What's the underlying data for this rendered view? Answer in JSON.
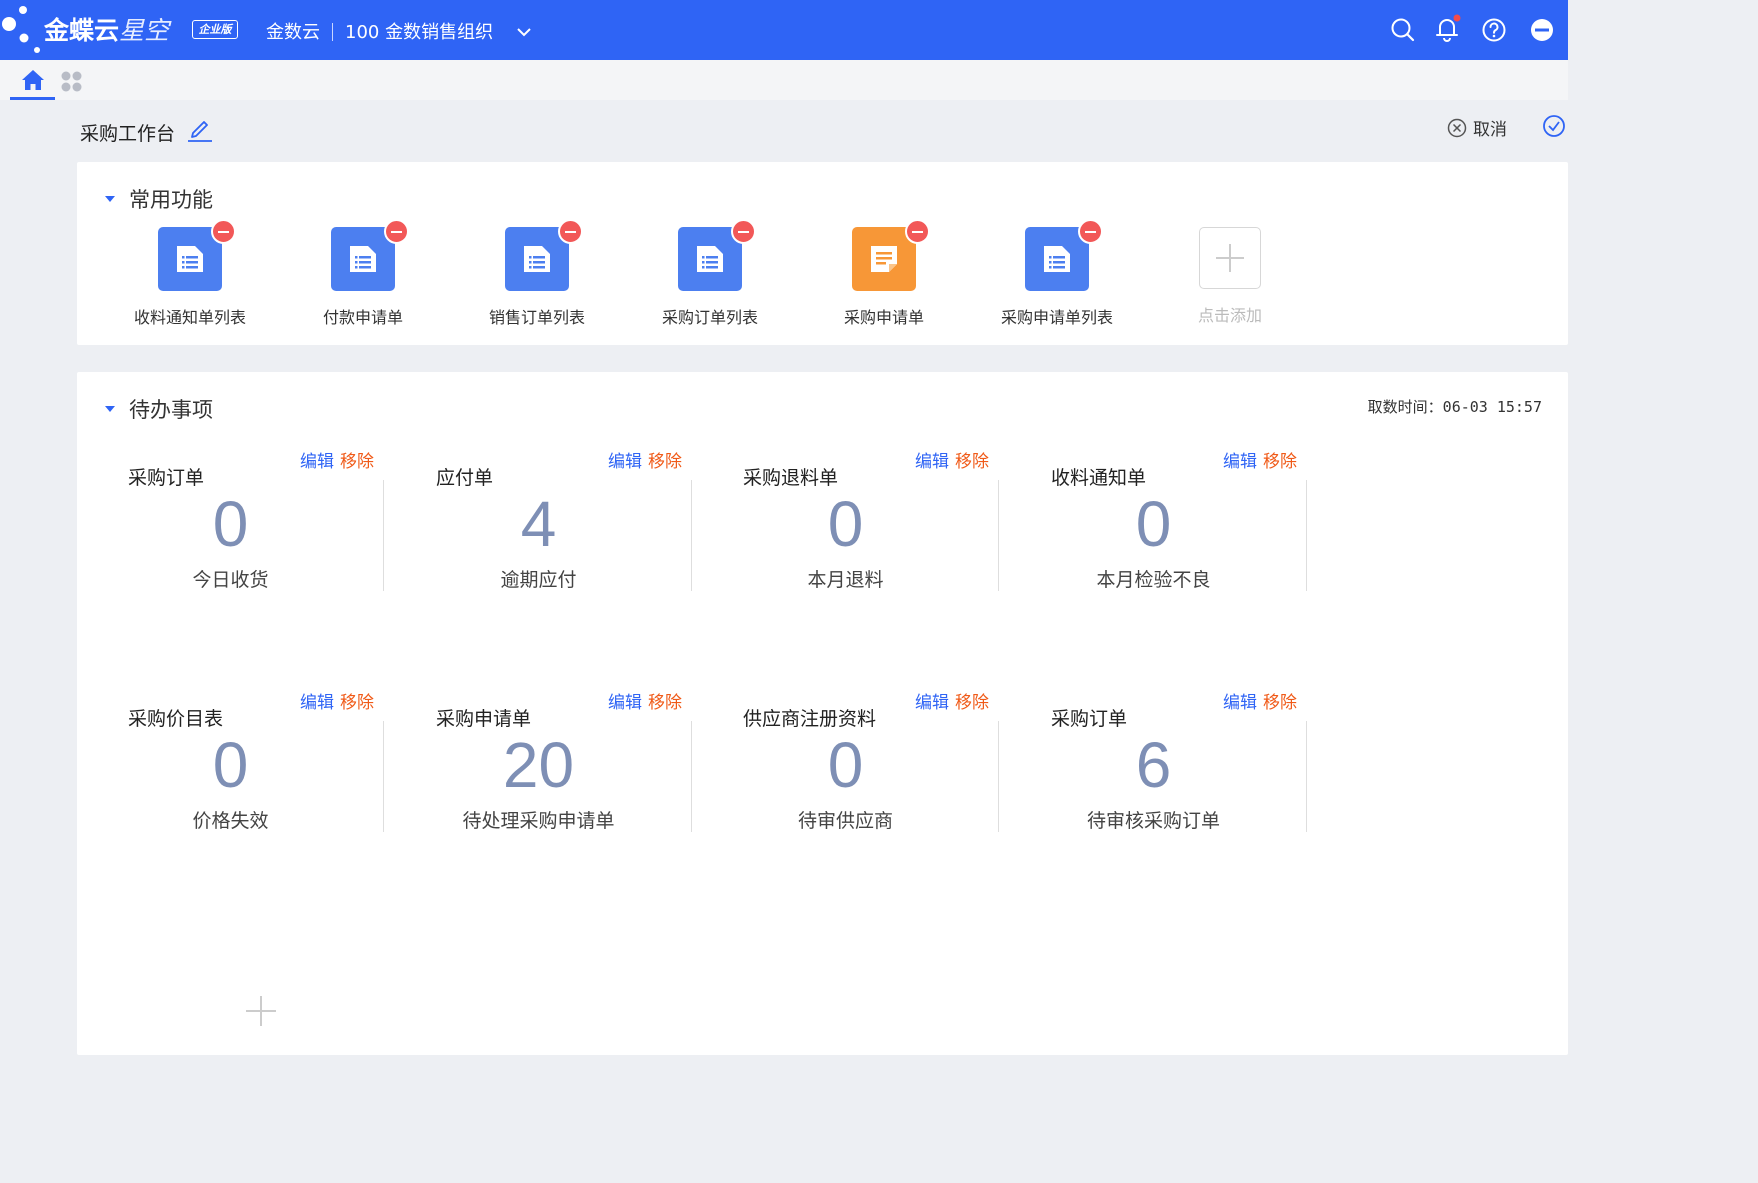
{
  "header": {
    "brand_primary": "金蝶云",
    "brand_secondary": "星空",
    "edition_badge": "企业版",
    "tenant": "金数云",
    "org": "100 金数销售组织",
    "accent_color": "#2f64f5",
    "icons": [
      "search-icon",
      "bell-icon",
      "help-icon",
      "user-menu-icon"
    ]
  },
  "tabs": {
    "icons": [
      "home-icon",
      "apps-grid-icon"
    ]
  },
  "page": {
    "title": "采购工作台",
    "cancel_label": "取消"
  },
  "common": {
    "title": "常用功能",
    "items": [
      {
        "label": "收料通知单列表",
        "color": "blue"
      },
      {
        "label": "付款申请单",
        "color": "blue"
      },
      {
        "label": "销售订单列表",
        "color": "blue"
      },
      {
        "label": "采购订单列表",
        "color": "blue"
      },
      {
        "label": "采购申请单",
        "color": "orange"
      },
      {
        "label": "采购申请单列表",
        "color": "blue"
      }
    ],
    "add_label": "点击添加"
  },
  "todo": {
    "title": "待办事项",
    "fetch_time": "取数时间：06-03 15:57",
    "edit_label": "编辑",
    "remove_label": "移除",
    "cards": [
      {
        "title": "采购订单",
        "value": "0",
        "label": "今日收货"
      },
      {
        "title": "应付单",
        "value": "4",
        "label": "逾期应付"
      },
      {
        "title": "采购退料单",
        "value": "0",
        "label": "本月退料"
      },
      {
        "title": "收料通知单",
        "value": "0",
        "label": "本月检验不良"
      },
      {
        "title": "采购价目表",
        "value": "0",
        "label": "价格失效"
      },
      {
        "title": "采购申请单",
        "value": "20",
        "label": "待处理采购申请单"
      },
      {
        "title": "供应商注册资料",
        "value": "0",
        "label": "待审供应商"
      },
      {
        "title": "采购订单",
        "value": "6",
        "label": "待审核采购订单"
      }
    ]
  }
}
